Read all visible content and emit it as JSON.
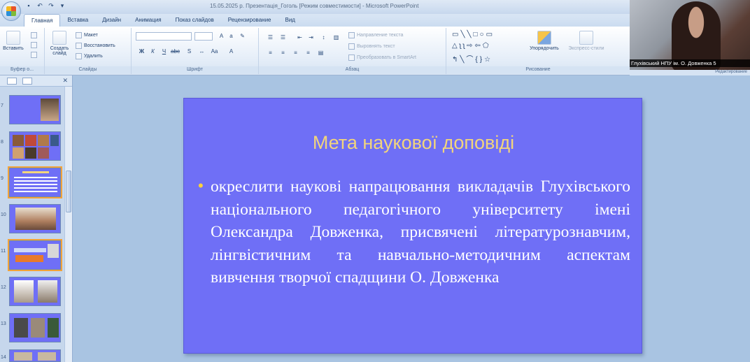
{
  "titlebar": {
    "title": "15.05.2025 р. Презентація_Гоголь [Режим совместимости] - Microsoft PowerPoint"
  },
  "tabs": [
    {
      "label": "Главная",
      "active": true
    },
    {
      "label": "Вставка"
    },
    {
      "label": "Дизайн"
    },
    {
      "label": "Анимация"
    },
    {
      "label": "Показ слайдов"
    },
    {
      "label": "Рецензирование"
    },
    {
      "label": "Вид"
    }
  ],
  "ribbon": {
    "clipboard": {
      "paste": "Вставить",
      "label": "Буфер о..."
    },
    "slides": {
      "new_slide": "Создать слайд",
      "layout": "Макет",
      "reset": "Восстановить",
      "delete": "Удалить",
      "label": "Слайды"
    },
    "font": {
      "label": "Шрифт"
    },
    "paragraph": {
      "text_direction": "Направление текста",
      "align_text": "Выровнять текст",
      "smartart": "Преобразовать в SmartArt",
      "label": "Абзац"
    },
    "drawing": {
      "arrange": "Упорядочить",
      "quick_styles": "Экспресс-стили",
      "label": "Рисование"
    },
    "editing": {
      "label": "Редактирование"
    }
  },
  "webcam": {
    "label": "Глухівський НПУ ім. О. Довженка 5"
  },
  "thumbnails": [
    {
      "num": "7"
    },
    {
      "num": "8"
    },
    {
      "num": "9",
      "selected": true
    },
    {
      "num": "10"
    },
    {
      "num": "11"
    },
    {
      "num": "12"
    },
    {
      "num": "13"
    },
    {
      "num": "14"
    }
  ],
  "slide": {
    "title": "Мета наукової доповіді",
    "bullet": "•",
    "body": "окреслити наукові напрацювання викладачів Глухівського національного педагогічного університету імені Олександра Довженка, присвячені літературознавчим, лінгвістичним та навчально-методичним аспектам вивчення творчої спадщини О. Довженка"
  },
  "colors": {
    "slide_bg": "#6f6ff6",
    "title_color": "#f2d57c",
    "bullet_color": "#ffd23a"
  }
}
